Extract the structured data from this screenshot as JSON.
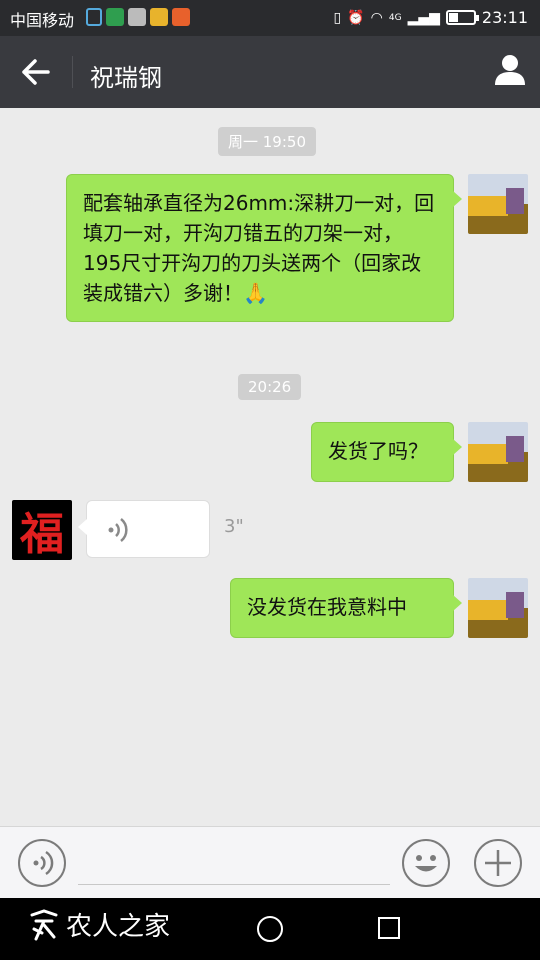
{
  "status_bar": {
    "carrier": "中国移动",
    "signal_label": "4G",
    "time": "23:11",
    "battery_level": 0.4
  },
  "header": {
    "title": "祝瑞钢",
    "back_icon": "arrow-left-icon",
    "user_icon": "person-icon"
  },
  "chat": {
    "timestamps": [
      "周一 19:50",
      "20:26"
    ],
    "messages": [
      {
        "from": "me",
        "type": "text",
        "text": "配套轴承直径为26mm:深耕刀一对，回填刀一对，开沟刀错五的刀架一对，195尺寸开沟刀的刀头送两个（回家改装成错六）多谢！",
        "emoji": "🙏"
      },
      {
        "from": "me",
        "type": "text",
        "text": "发货了吗？"
      },
      {
        "from": "other",
        "type": "voice",
        "duration": "3\""
      },
      {
        "from": "me",
        "type": "text",
        "text": "没发货在我意料中"
      }
    ],
    "other_avatar_char": "福"
  },
  "input_bar": {
    "placeholder": "",
    "voice_icon": "voice-icon",
    "emoji_icon": "emoji-icon",
    "plus_icon": "plus-icon"
  },
  "nav_bar": {
    "watermark": "农人之家"
  },
  "colors": {
    "header_bg": "#393a3f",
    "bubble_green": "#9fe658",
    "chat_bg": "#ebebeb"
  }
}
